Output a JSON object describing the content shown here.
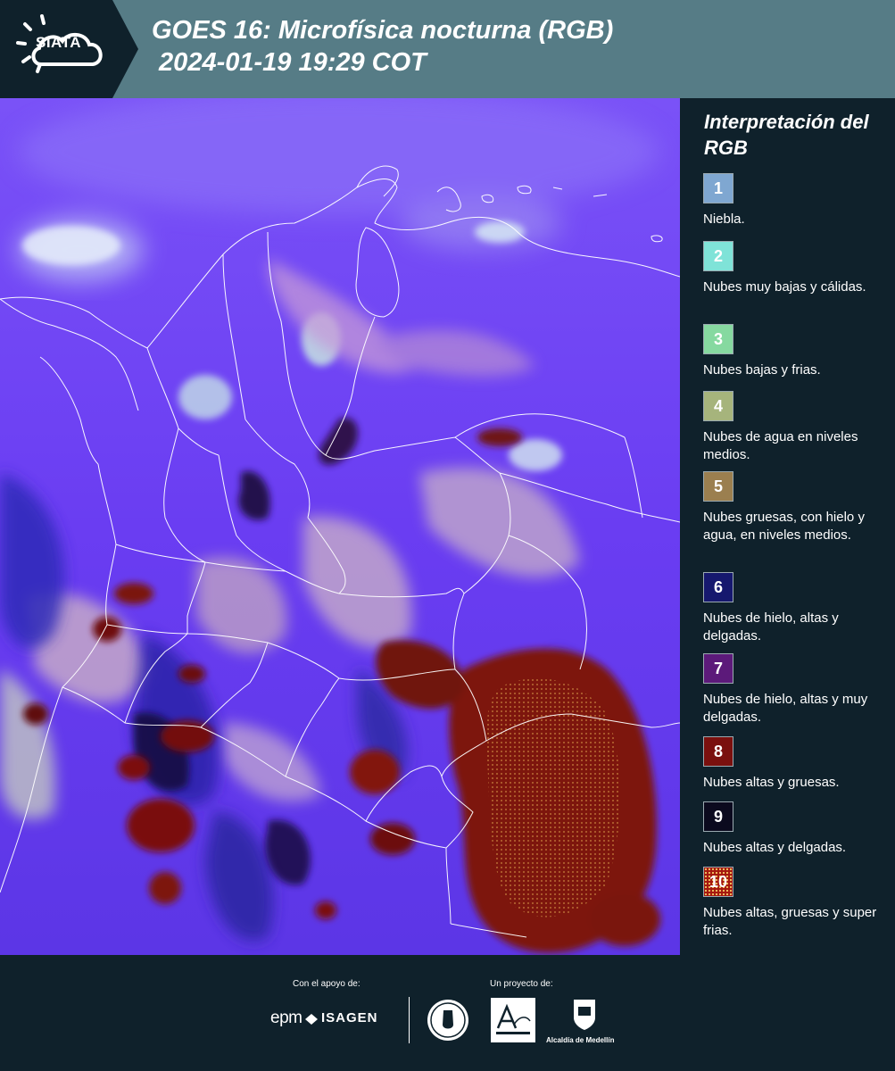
{
  "header": {
    "logo_text": "SIATA",
    "title": "GOES 16: Microfísica nocturna (RGB)\n 2024-01-19 19:29 COT"
  },
  "map": {
    "background_color": "#6b3cf2",
    "border_color": "#ffffff"
  },
  "legend": {
    "title": "Interpretación del RGB",
    "items": [
      {
        "number": "1",
        "label": "Niebla.",
        "color": "#7fa7d1"
      },
      {
        "number": "2",
        "label": "Nubes muy bajas y cálidas.",
        "color": "#7fe3d8"
      },
      {
        "number": "3",
        "label": "Nubes bajas y frias.",
        "color": "#86d9a0"
      },
      {
        "number": "4",
        "label": "Nubes de agua en niveles medios.",
        "color": "#a6b47c"
      },
      {
        "number": "5",
        "label": "Nubes gruesas, con hielo y agua, en niveles medios.",
        "color": "#9b7f4f"
      },
      {
        "number": "6",
        "label": "Nubes de hielo, altas y delgadas.",
        "color": "#16186e"
      },
      {
        "number": "7",
        "label": "Nubes de hielo, altas y muy delgadas.",
        "color": "#5c1a7a"
      },
      {
        "number": "8",
        "label": "Nubes altas y gruesas.",
        "color": "#7a100e"
      },
      {
        "number": "9",
        "label": "Nubes altas y delgadas.",
        "color": "#0b0a1e"
      },
      {
        "number": "10",
        "label": "Nubes altas, gruesas y super frias.",
        "color": "#a5170e"
      }
    ]
  },
  "footer": {
    "support_label": "Con el apoyo de:",
    "project_label": "Un proyecto de:",
    "sponsor_1": "epm",
    "sponsor_2": "ISAGEN",
    "partner_3": "Alcaldía de Medellín"
  }
}
